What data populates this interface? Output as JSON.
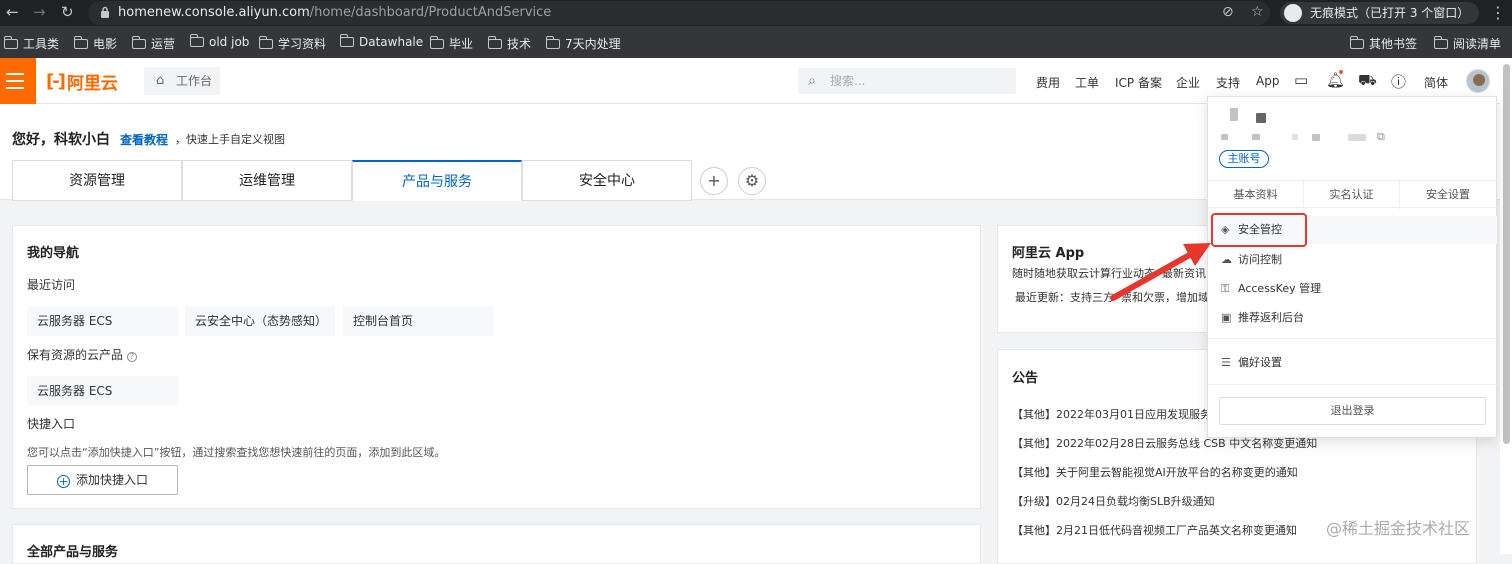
{
  "browser": {
    "url_host": "homenew.console.aliyun.com",
    "url_path": "/home/dashboard/ProductAndService",
    "incognito_label": "无痕模式（已打开 3 个窗口）",
    "bookmarks": [
      "工具类",
      "电影",
      "运营",
      "old job",
      "学习资料",
      "Datawhale",
      "毕业",
      "技术",
      "7天内处理"
    ],
    "bookmarks_right": [
      "其他书签",
      "阅读清单"
    ]
  },
  "header": {
    "logo_text": "阿里云",
    "workbench_label": "工作台",
    "search_placeholder": "搜索...",
    "nav": [
      "费用",
      "工单",
      "ICP 备案",
      "企业",
      "支持",
      "App"
    ],
    "lang_label": "简体",
    "accent_color": "#ff6a00"
  },
  "greeting": {
    "hello": "您好，科软小白",
    "tutorial_link": "查看教程",
    "tip": "，快速上手自定义视图"
  },
  "tabs": [
    "资源管理",
    "运维管理",
    "产品与服务",
    "安全中心"
  ],
  "active_tab": "产品与服务",
  "my_nav": {
    "title": "我的导航",
    "recent_label": "最近访问",
    "recent": [
      "云服务器 ECS",
      "云安全中心（态势感知）",
      "控制台首页"
    ],
    "owned_label": "保有资源的云产品",
    "owned": [
      "云服务器 ECS"
    ],
    "shortcut_label": "快捷入口",
    "shortcut_tip": "您可以点击“添加快捷入口”按钮，通过搜索查找您想快速前往的页面，添加到此区域。",
    "add_button": "添加快捷入口"
  },
  "all_products_title": "全部产品与服务",
  "app_card": {
    "title": "阿里云 App",
    "line1": "随时随地获取云计算行业动态",
    "line1_tail": "最新资讯",
    "line2": "最近更新：支持三方",
    "line2_mid": "票和欠票，增加域"
  },
  "announcements": {
    "title": "公告",
    "items": [
      "【其他】2022年03月01日应用发现服务",
      "【其他】2022年02月28日云服务总线 CSB 中文名称变更通知",
      "【其他】关于阿里云智能视觉AI开放平台的名称变更的通知",
      "【升级】02月24日负载均衡SLB升级通知",
      "【其他】2月21日低代码音视频工厂产品英文名称变更通知"
    ]
  },
  "dropdown": {
    "badge": "主账号",
    "tabs": [
      "基本资料",
      "实名认证",
      "安全设置"
    ],
    "items": [
      "安全管控",
      "访问控制",
      "AccessKey 管理",
      "推荐返利后台"
    ],
    "prefs": "偏好设置",
    "logout": "退出登录",
    "highlight_color": "#e8362d"
  },
  "watermark": "@稀土掘金技术社区"
}
